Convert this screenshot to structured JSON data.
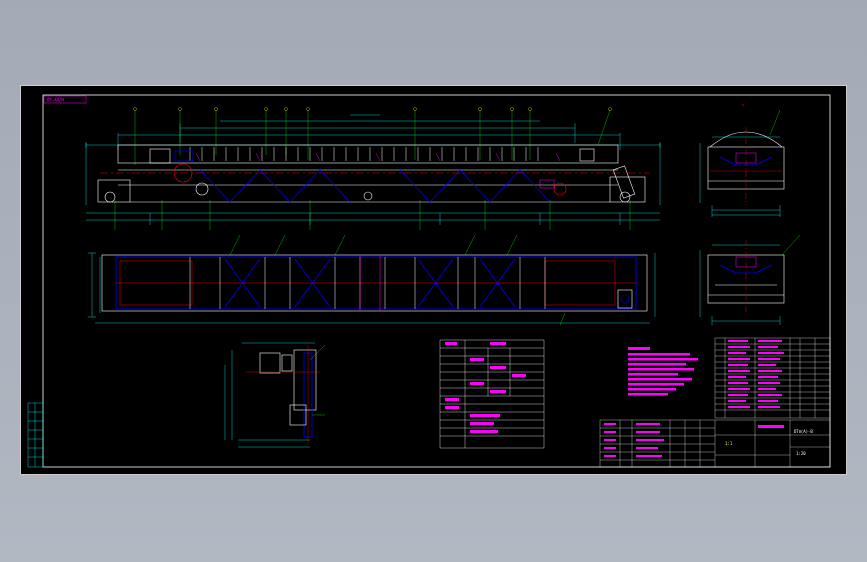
{
  "drawing": {
    "sheet_tag": "DS-A4/H",
    "title_block": {
      "drawing_no": "DTⅡ(A)-B",
      "sheet_label": "1:1",
      "scale": "1:20"
    }
  },
  "colors": {
    "background": "#000000",
    "viewport": "#a9b0bb",
    "frame": "#ffffff",
    "structure": "#ffffff",
    "conveyor": "#0000ff",
    "dimension": "#00ffff",
    "centerline": "#ff0000",
    "leader": "#00ff00",
    "notes": "#ff00ff",
    "labels": "#ffff00"
  },
  "icons": {
    "drive-pulley": "circle",
    "tail-pulley": "circle",
    "idler-roller": "circle",
    "motor": "rectangle"
  }
}
